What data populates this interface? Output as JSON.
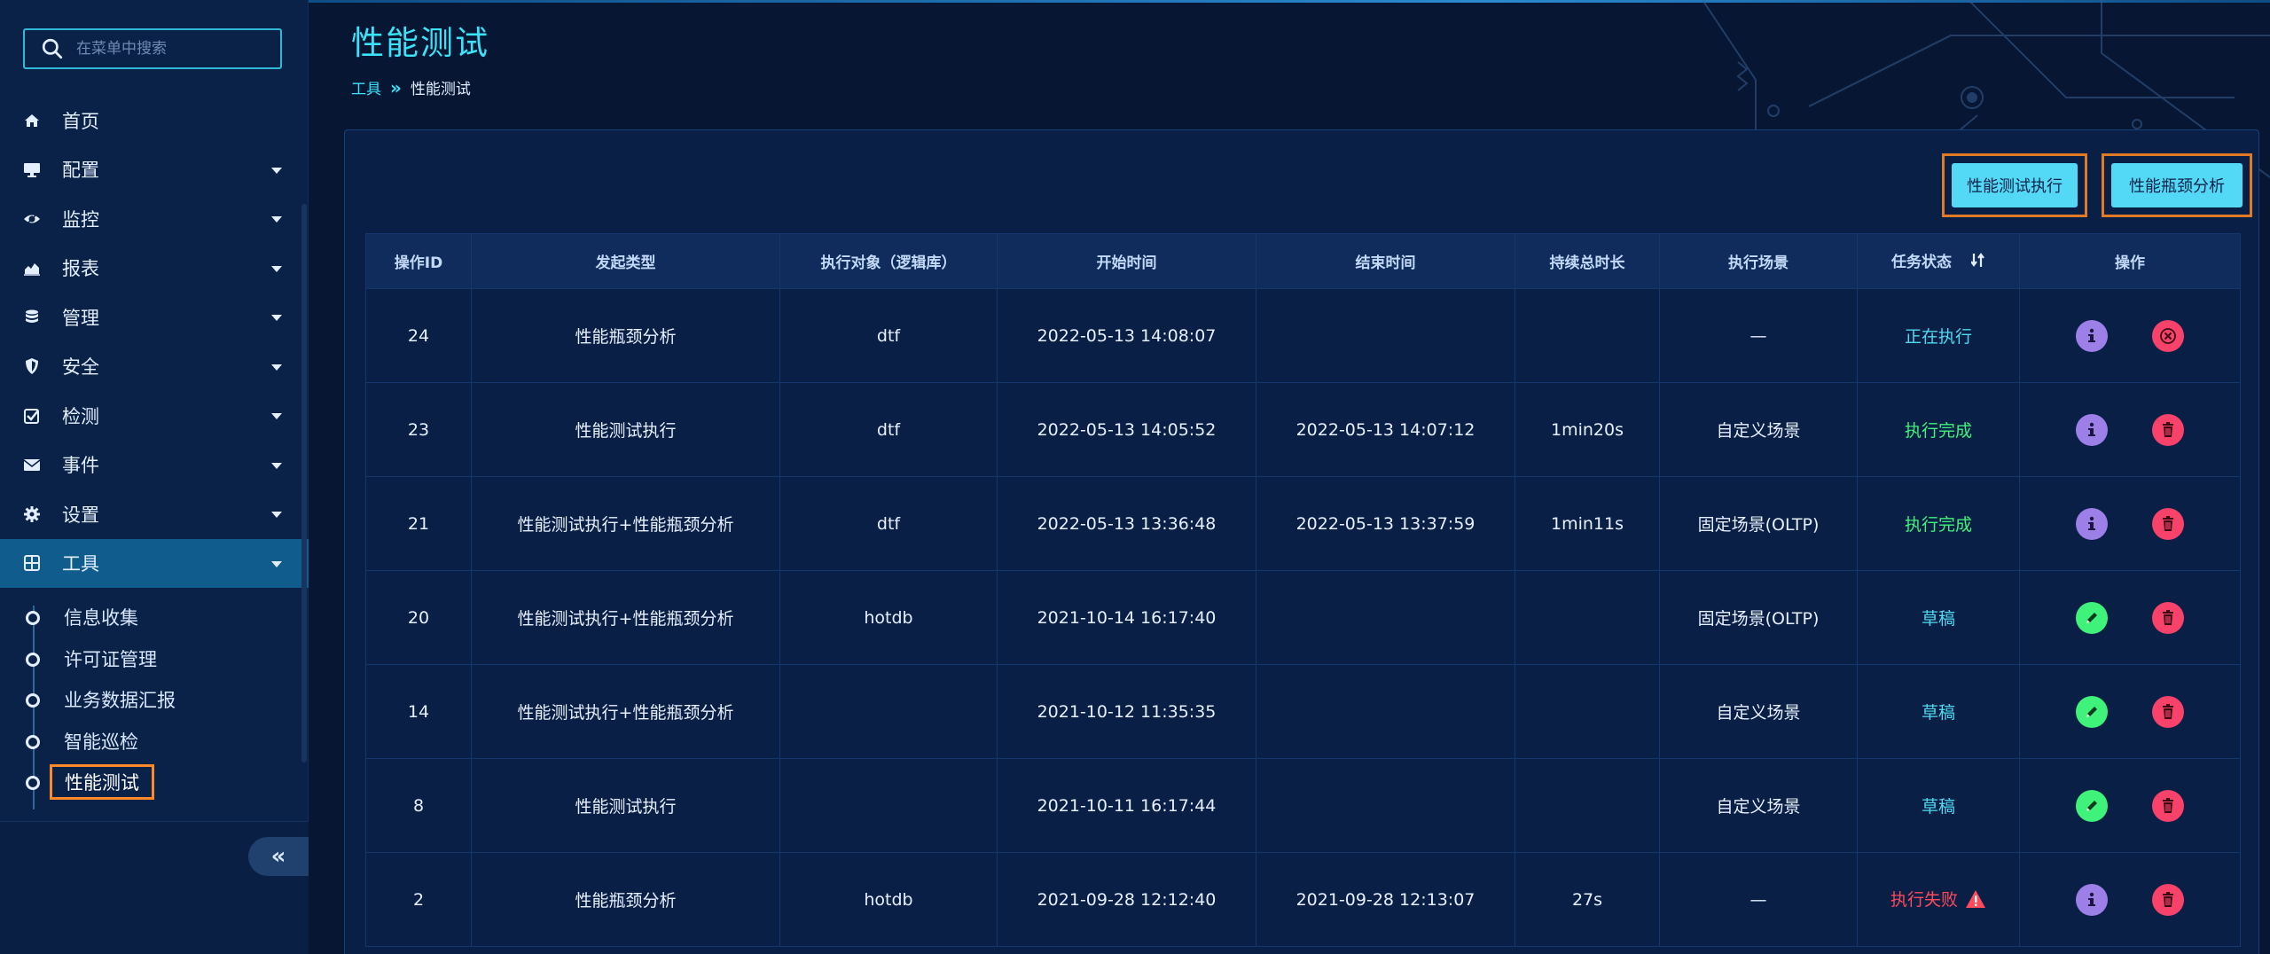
{
  "sidebar": {
    "search_placeholder": "在菜单中搜索",
    "items": [
      {
        "label": "首页",
        "icon": "home-icon",
        "has_caret": false
      },
      {
        "label": "配置",
        "icon": "monitor-icon",
        "has_caret": true
      },
      {
        "label": "监控",
        "icon": "eye-icon",
        "has_caret": true
      },
      {
        "label": "报表",
        "icon": "area-chart-icon",
        "has_caret": true
      },
      {
        "label": "管理",
        "icon": "database-icon",
        "has_caret": true
      },
      {
        "label": "安全",
        "icon": "shield-icon",
        "has_caret": true
      },
      {
        "label": "检测",
        "icon": "checkbox-icon",
        "has_caret": true
      },
      {
        "label": "事件",
        "icon": "envelope-icon",
        "has_caret": true
      },
      {
        "label": "设置",
        "icon": "gear-icon",
        "has_caret": true
      },
      {
        "label": "工具",
        "icon": "grid-icon",
        "has_caret": true,
        "active": true
      }
    ],
    "submenu": [
      {
        "label": "信息收集"
      },
      {
        "label": "许可证管理"
      },
      {
        "label": "业务数据汇报"
      },
      {
        "label": "智能巡检"
      },
      {
        "label": "性能测试",
        "current": true
      }
    ],
    "collapse_label": "«"
  },
  "page": {
    "title": "性能测试",
    "breadcrumb": {
      "parent": "工具",
      "separator": "»",
      "current": "性能测试"
    }
  },
  "toolbar": {
    "run_label": "性能测试执行",
    "analyze_label": "性能瓶颈分析"
  },
  "table": {
    "headers": [
      "操作ID",
      "发起类型",
      "执行对象（逻辑库）",
      "开始时间",
      "结束时间",
      "持续总时长",
      "执行场景",
      "任务状态",
      "操作"
    ],
    "rows": [
      {
        "id": "24",
        "type": "性能瓶颈分析",
        "target": "dtf",
        "start": "2022-05-13 14:08:07",
        "end": "",
        "duration": "",
        "scene": "—",
        "status": "正在执行",
        "status_kind": "running",
        "ops": [
          "info",
          "cancel"
        ]
      },
      {
        "id": "23",
        "type": "性能测试执行",
        "target": "dtf",
        "start": "2022-05-13 14:05:52",
        "end": "2022-05-13 14:07:12",
        "duration": "1min20s",
        "scene": "自定义场景",
        "status": "执行完成",
        "status_kind": "done",
        "ops": [
          "info",
          "delete"
        ]
      },
      {
        "id": "21",
        "type": "性能测试执行+性能瓶颈分析",
        "target": "dtf",
        "start": "2022-05-13 13:36:48",
        "end": "2022-05-13 13:37:59",
        "duration": "1min11s",
        "scene": "固定场景(OLTP)",
        "status": "执行完成",
        "status_kind": "done",
        "ops": [
          "info",
          "delete"
        ]
      },
      {
        "id": "20",
        "type": "性能测试执行+性能瓶颈分析",
        "target": "hotdb",
        "start": "2021-10-14 16:17:40",
        "end": "",
        "duration": "",
        "scene": "固定场景(OLTP)",
        "status": "草稿",
        "status_kind": "draft",
        "ops": [
          "edit",
          "delete"
        ]
      },
      {
        "id": "14",
        "type": "性能测试执行+性能瓶颈分析",
        "target": "",
        "start": "2021-10-12 11:35:35",
        "end": "",
        "duration": "",
        "scene": "自定义场景",
        "status": "草稿",
        "status_kind": "draft",
        "ops": [
          "edit",
          "delete"
        ]
      },
      {
        "id": "8",
        "type": "性能测试执行",
        "target": "",
        "start": "2021-10-11 16:17:44",
        "end": "",
        "duration": "",
        "scene": "自定义场景",
        "status": "草稿",
        "status_kind": "draft",
        "ops": [
          "edit",
          "delete"
        ]
      },
      {
        "id": "2",
        "type": "性能瓶颈分析",
        "target": "hotdb",
        "start": "2021-09-28 12:12:40",
        "end": "2021-09-28 12:13:07",
        "duration": "27s",
        "scene": "—",
        "status": "执行失败",
        "status_kind": "fail",
        "ops": [
          "info",
          "delete"
        ]
      }
    ]
  },
  "colors": {
    "accent": "#3ce2f8",
    "running": "#4fd9f0",
    "done": "#3ef27a",
    "fail": "#ff4a5c",
    "info_btn": "#9d7fe8",
    "edit_btn": "#3ef27a",
    "delete_btn": "#f8426a",
    "highlight_border": "#e07a25"
  }
}
